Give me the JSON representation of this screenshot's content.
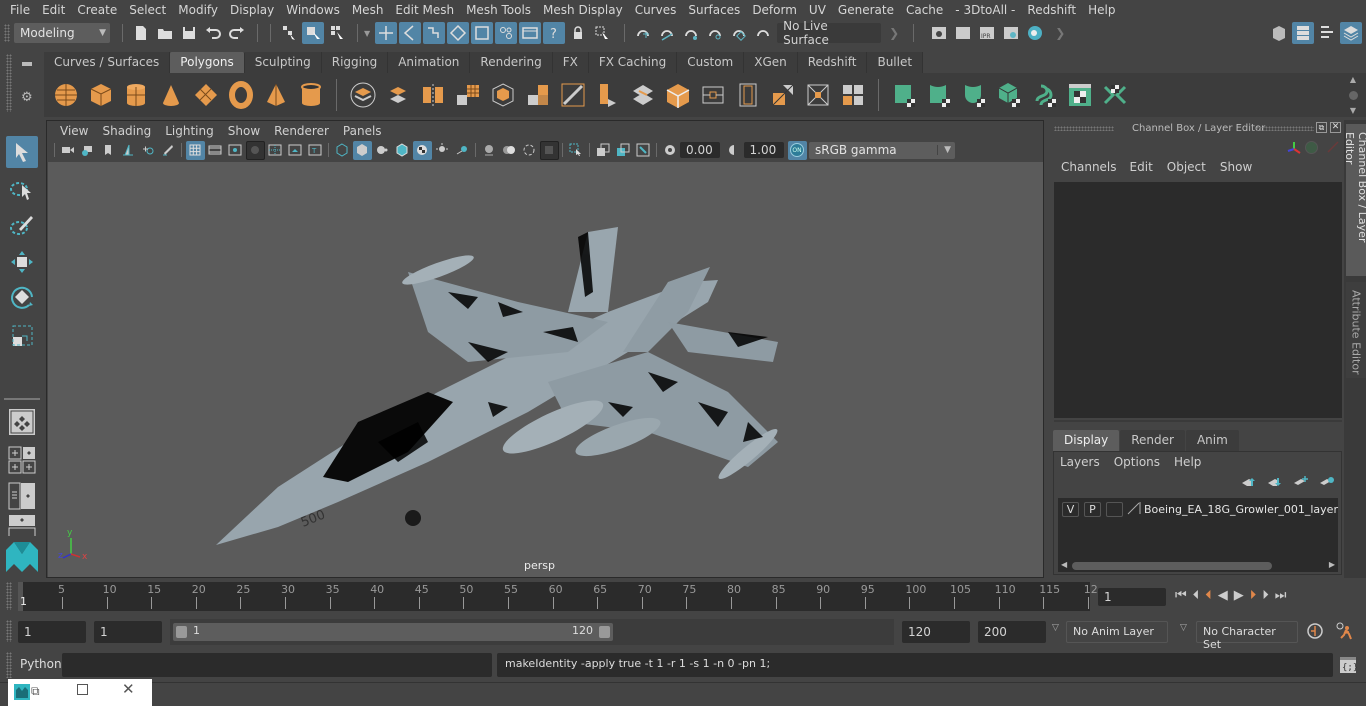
{
  "menubar": {
    "items": [
      "File",
      "Edit",
      "Create",
      "Select",
      "Modify",
      "Display",
      "Windows",
      "Mesh",
      "Edit Mesh",
      "Mesh Tools",
      "Mesh Display",
      "Curves",
      "Surfaces",
      "Deform",
      "UV",
      "Generate",
      "Cache",
      "- 3DtoAll -",
      "Redshift",
      "Help"
    ]
  },
  "statusline": {
    "workspace": "Modeling",
    "live_surface": "No Live Surface",
    "icons": [
      "new-scene-icon",
      "open-scene-icon",
      "save-scene-icon",
      "undo-icon",
      "redo-icon",
      "select-hierarchy-icon",
      "select-object-icon",
      "select-component-icon",
      "snap-grid-icon",
      "snap-curve-icon",
      "snap-point-icon",
      "snap-view-plane-icon",
      "snap-surface-icon",
      "snap-vertex-icon",
      "snap-frame-icon",
      "help-icon",
      "lock-icon",
      "select-highlight-icon",
      "make-live-icon",
      "render-view-icon",
      "render-current-icon",
      "ipr-render-icon",
      "render-settings-icon",
      "hypershade-icon"
    ],
    "right_icons": [
      "modeling-toolkit-icon",
      "attribute-editor-toggle-icon",
      "tool-settings-icon",
      "channel-box-toggle-icon"
    ]
  },
  "shelf": {
    "tabs": [
      "Curves / Surfaces",
      "Polygons",
      "Sculpting",
      "Rigging",
      "Animation",
      "Rendering",
      "FX",
      "FX Caching",
      "Custom",
      "XGen",
      "Redshift",
      "Bullet"
    ],
    "active_tab": "Polygons",
    "icons_poly": [
      "poly-sphere-icon",
      "poly-cube-icon",
      "poly-cylinder-icon",
      "poly-cone-icon",
      "poly-plane-icon",
      "poly-torus-icon",
      "poly-pyramid-icon",
      "poly-pipe-icon"
    ],
    "icons_ops": [
      "combine-icon",
      "separate-icon",
      "mirror-icon",
      "smooth-icon",
      "poly-reduce-icon",
      "extrude-icon",
      "bevel-icon",
      "bridge-icon",
      "multi-cut-icon",
      "target-weld-icon",
      "append-poly-icon",
      "extract-icon",
      "merge-icon",
      "insert-edge-loop-icon",
      "offset-edge-loop-icon",
      "poly-split-icon",
      "collapse-icon",
      "fill-hole-icon"
    ],
    "icons_uv": [
      "planar-uv-icon",
      "cylindrical-uv-icon",
      "spherical-uv-icon",
      "automatic-uv-icon",
      "unfold-uv-icon",
      "uv-editor-icon",
      "layout-uv-icon"
    ]
  },
  "toolbox": {
    "tools": [
      "select-tool-icon",
      "lasso-tool-icon",
      "paint-select-tool-icon",
      "move-tool-icon",
      "rotate-tool-icon",
      "scale-tool-icon"
    ],
    "layouts": [
      "single-view-layout-icon",
      "four-view-layout-icon",
      "outliner-persp-layout-icon",
      "persp-graph-layout-icon"
    ]
  },
  "viewport": {
    "menu": [
      "View",
      "Shading",
      "Lighting",
      "Show",
      "Renderer",
      "Panels"
    ],
    "exposure": "0.00",
    "gamma": "1.00",
    "color_toggle": "ON",
    "color_space": "sRGB gamma",
    "camera_label": "persp",
    "axis": {
      "x": "x",
      "y": "y",
      "z": "z"
    },
    "model_number": "500"
  },
  "channel_box": {
    "title": "Channel Box / Layer Editor",
    "menu": [
      "Channels",
      "Edit",
      "Object",
      "Show"
    ]
  },
  "layer_editor": {
    "tabs": [
      "Display",
      "Render",
      "Anim"
    ],
    "active_tab": "Display",
    "menu": [
      "Layers",
      "Options",
      "Help"
    ],
    "layers": [
      {
        "visible": "V",
        "playback": "P",
        "name": "Boeing_EA_18G_Growler_001_layer"
      }
    ]
  },
  "side_tabs": [
    "Channel Box / Layer Editor",
    "Attribute Editor"
  ],
  "timeline": {
    "ticks": [
      "5",
      "10",
      "15",
      "20",
      "25",
      "30",
      "35",
      "40",
      "45",
      "50",
      "55",
      "60",
      "65",
      "70",
      "75",
      "80",
      "85",
      "90",
      "95",
      "100",
      "105",
      "110",
      "115",
      "12"
    ],
    "current_frame_marker": "1",
    "current_frame": "1"
  },
  "range": {
    "start": "1",
    "playback_start": "1",
    "slider_min": "1",
    "slider_max": "120",
    "playback_end": "120",
    "end": "200",
    "anim_layer": "No Anim Layer",
    "character_set": "No Character Set"
  },
  "cmdline": {
    "language": "Python",
    "input": "",
    "result": "makeIdentity -apply true -t 1 -r 1 -s 1 -n 0 -pn 1;"
  }
}
